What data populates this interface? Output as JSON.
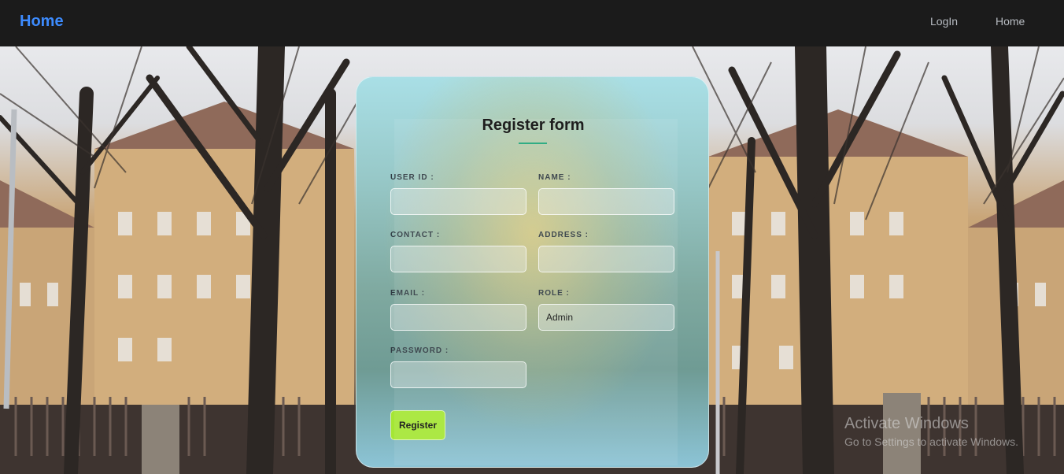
{
  "navbar": {
    "brand": "Home",
    "links": [
      "LogIn",
      "Home"
    ]
  },
  "form": {
    "title": "Register form",
    "fields": {
      "user_id": {
        "label": "USER ID :",
        "value": ""
      },
      "name": {
        "label": "NAME :",
        "value": ""
      },
      "contact": {
        "label": "CONTACT :",
        "value": ""
      },
      "address": {
        "label": "ADDRESS :",
        "value": ""
      },
      "email": {
        "label": "EMAIL :",
        "value": ""
      },
      "role": {
        "label": "ROLE :",
        "value": "Admin"
      },
      "password": {
        "label": "PASSWORD :",
        "value": ""
      }
    },
    "submit_label": "Register"
  },
  "watermark": {
    "title": "Activate Windows",
    "subtitle": "Go to Settings to activate Windows."
  },
  "colors": {
    "brand": "#3d8bfd",
    "navbar_bg": "#1b1b1b",
    "accent_underline": "#1fa67a",
    "button_bg": "#a5e635"
  }
}
